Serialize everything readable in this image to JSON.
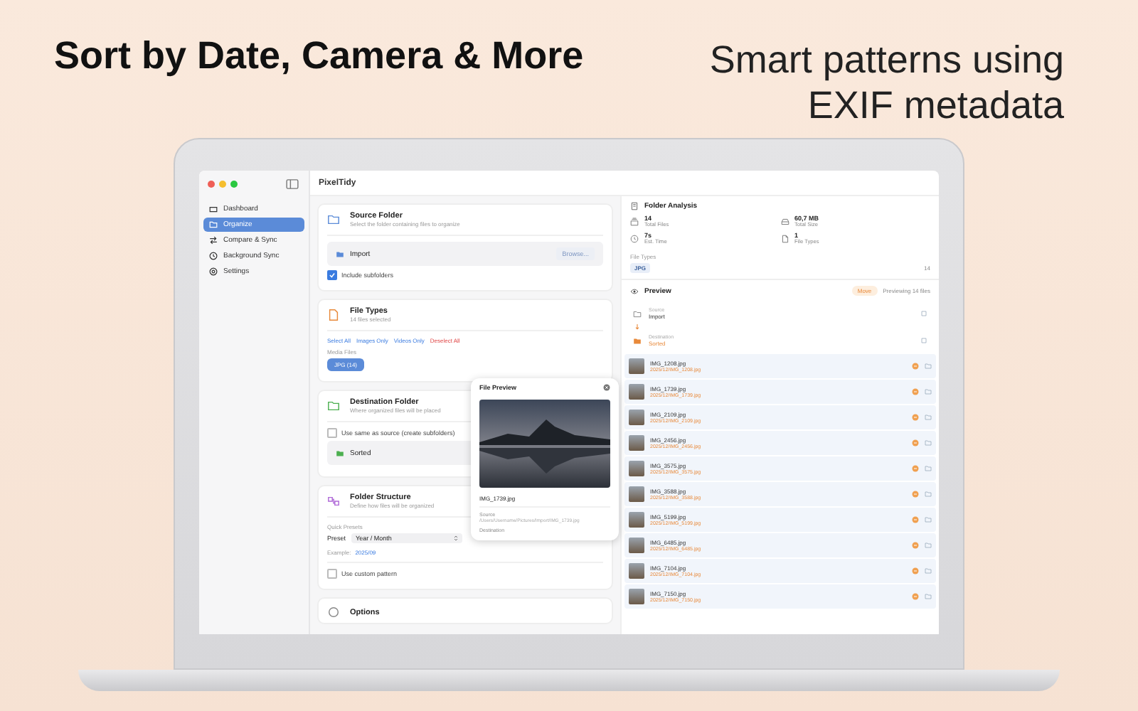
{
  "headline": "Sort by Date, Camera & More",
  "subheadline": [
    "Smart patterns using",
    "EXIF metadata"
  ],
  "app": {
    "title": "PixelTidy"
  },
  "sidebar": [
    {
      "label": "Dashboard",
      "kind": "dashboard",
      "selected": false
    },
    {
      "label": "Organize",
      "kind": "organize",
      "selected": true
    },
    {
      "label": "Compare & Sync",
      "kind": "compare",
      "selected": false
    },
    {
      "label": "Background Sync",
      "kind": "clock",
      "selected": false
    },
    {
      "label": "Settings",
      "kind": "gear",
      "selected": false
    }
  ],
  "source": {
    "title": "Source Folder",
    "subtitle": "Select the folder containing files to organize",
    "folder": "Import",
    "browse": "Browse...",
    "include_subfolders": {
      "label": "Include subfolders",
      "checked": true
    }
  },
  "file_types": {
    "title": "File Types",
    "subtitle": "14 files selected",
    "actions": [
      {
        "label": "Select All",
        "kind": "normal"
      },
      {
        "label": "Images Only",
        "kind": "normal"
      },
      {
        "label": "Videos Only",
        "kind": "normal"
      },
      {
        "label": "Deselect All",
        "kind": "danger"
      }
    ],
    "media_label": "Media Files",
    "chips": [
      {
        "label": "JPG",
        "count": "(14)",
        "selected": true
      }
    ]
  },
  "destination": {
    "title": "Destination Folder",
    "subtitle": "Where organized files will be placed",
    "same_as_source": {
      "label": "Use same as source (create subfolders)",
      "checked": false
    },
    "folder": "Sorted"
  },
  "structure": {
    "title": "Folder Structure",
    "subtitle": "Define how files will be organized",
    "presets_label": "Quick Presets",
    "preset_label": "Preset",
    "preset_value": "Year / Month",
    "example_label": "Example:",
    "example_value": "2025/09",
    "custom": {
      "label": "Use custom pattern",
      "checked": false
    }
  },
  "options": {
    "title": "Options"
  },
  "popup": {
    "title": "File Preview",
    "name": "IMG_1739.jpg",
    "source_label": "Source",
    "source_path": "/Users/Username/Pictures/Import/IMG_1739.jpg",
    "destination_label": "Destination"
  },
  "analysis": {
    "title": "Folder Analysis",
    "stats": [
      {
        "value": "14",
        "label": "Total Files",
        "kind": "stack"
      },
      {
        "value": "60,7 MB",
        "label": "Total Size",
        "kind": "drive"
      },
      {
        "value": "7s",
        "label": "Est. Time",
        "kind": "clock"
      },
      {
        "value": "1",
        "label": "File Types",
        "kind": "doc"
      }
    ],
    "types_label": "File Types",
    "types": [
      {
        "label": "JPG",
        "count": "14"
      }
    ]
  },
  "preview": {
    "title": "Preview",
    "mode": "Move",
    "status": "Previewing 14 files",
    "source": {
      "label": "Source",
      "value": "Import"
    },
    "destination": {
      "label": "Destination",
      "value": "Sorted"
    },
    "files": [
      {
        "name": "IMG_1208.jpg",
        "path": "2025/12/IMG_1208.jpg"
      },
      {
        "name": "IMG_1739.jpg",
        "path": "2025/12/IMG_1739.jpg"
      },
      {
        "name": "IMG_2109.jpg",
        "path": "2025/12/IMG_2109.jpg"
      },
      {
        "name": "IMG_2456.jpg",
        "path": "2025/12/IMG_2456.jpg"
      },
      {
        "name": "IMG_3575.jpg",
        "path": "2025/12/IMG_3575.jpg"
      },
      {
        "name": "IMG_3588.jpg",
        "path": "2025/12/IMG_3588.jpg"
      },
      {
        "name": "IMG_5199.jpg",
        "path": "2025/12/IMG_5199.jpg"
      },
      {
        "name": "IMG_6485.jpg",
        "path": "2025/12/IMG_6485.jpg"
      },
      {
        "name": "IMG_7104.jpg",
        "path": "2025/12/IMG_7104.jpg"
      },
      {
        "name": "IMG_7150.jpg",
        "path": "2025/12/IMG_7150.jpg"
      }
    ]
  }
}
